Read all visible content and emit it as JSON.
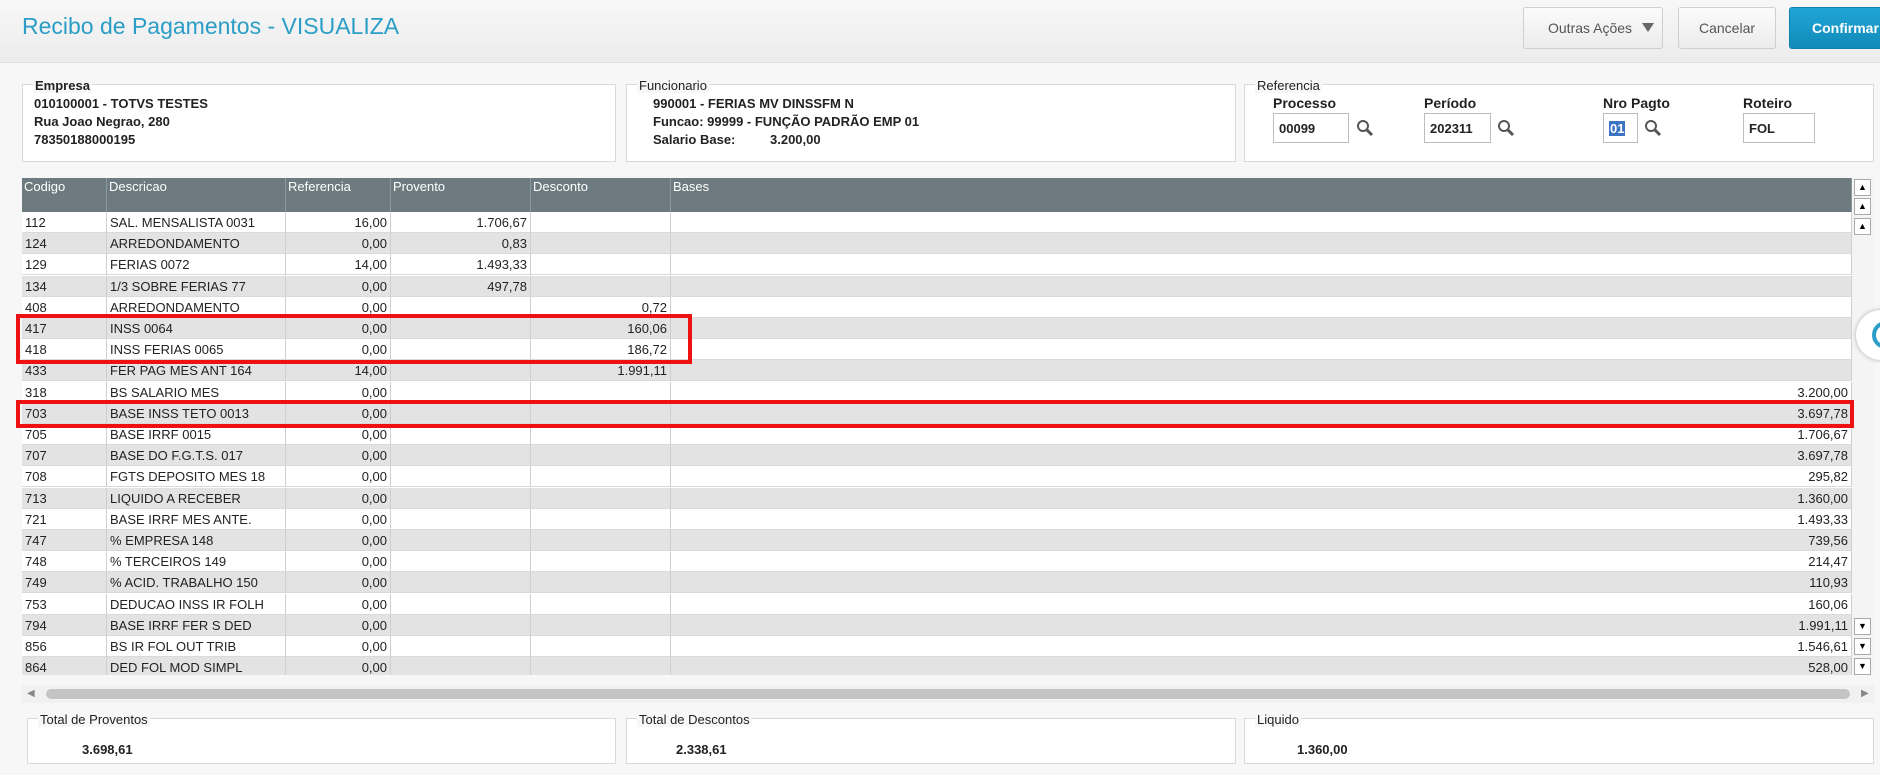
{
  "header": {
    "title": "Recibo de Pagamentos - VISUALIZA",
    "outras_acoes": "Outras Ações",
    "cancelar": "Cancelar",
    "confirmar": "Confirmar"
  },
  "empresa": {
    "legend": "Empresa",
    "line1": "010100001 - TOTVS TESTES",
    "line2": "Rua Joao Negrao, 280",
    "line3": "78350188000195"
  },
  "funcionario": {
    "legend": "Funcionario",
    "line1": "990001 - FERIAS MV DINSSFM N",
    "line2": "Funcao: 99999  - FUNÇÃO PADRÃO EMP 01",
    "salario_label": "Salario Base:",
    "salario_value": "3.200,00"
  },
  "referencia": {
    "legend": "Referencia",
    "processo_label": "Processo",
    "processo_value": "00099",
    "periodo_label": "Período",
    "periodo_value": "202311",
    "nro_label": "Nro Pagto",
    "nro_value": "01",
    "roteiro_label": "Roteiro",
    "roteiro_value": "FOL"
  },
  "grid": {
    "columns": [
      "Codigo",
      "Descricao",
      "Referencia",
      "Provento",
      "Desconto",
      "Bases"
    ],
    "rows": [
      [
        "112",
        "SAL. MENSALISTA 0031",
        "16,00",
        "1.706,67",
        "",
        ""
      ],
      [
        "124",
        "ARREDONDAMENTO",
        "0,00",
        "0,83",
        "",
        ""
      ],
      [
        "129",
        "FERIAS 0072",
        "14,00",
        "1.493,33",
        "",
        ""
      ],
      [
        "134",
        "1/3 SOBRE FERIAS 77",
        "0,00",
        "497,78",
        "",
        ""
      ],
      [
        "408",
        "ARREDONDAMENTO",
        "0,00",
        "",
        "0,72",
        ""
      ],
      [
        "417",
        "INSS 0064",
        "0,00",
        "",
        "160,06",
        ""
      ],
      [
        "418",
        "INSS FERIAS 0065",
        "0,00",
        "",
        "186,72",
        ""
      ],
      [
        "433",
        "FER PAG MES ANT 164",
        "14,00",
        "",
        "1.991,11",
        ""
      ],
      [
        "318",
        "BS SALARIO MES",
        "0,00",
        "",
        "",
        "3.200,00"
      ],
      [
        "703",
        "BASE INSS TETO 0013",
        "0,00",
        "",
        "",
        "3.697,78"
      ],
      [
        "705",
        "BASE IRRF 0015",
        "0,00",
        "",
        "",
        "1.706,67"
      ],
      [
        "707",
        "BASE DO F.G.T.S. 017",
        "0,00",
        "",
        "",
        "3.697,78"
      ],
      [
        "708",
        "FGTS DEPOSITO MES 18",
        "0,00",
        "",
        "",
        "295,82"
      ],
      [
        "713",
        "LIQUIDO A RECEBER",
        "0,00",
        "",
        "",
        "1.360,00"
      ],
      [
        "721",
        "BASE IRRF MES ANTE.",
        "0,00",
        "",
        "",
        "1.493,33"
      ],
      [
        "747",
        "% EMPRESA  148",
        "0,00",
        "",
        "",
        "739,56"
      ],
      [
        "748",
        "% TERCEIROS 149",
        "0,00",
        "",
        "",
        "214,47"
      ],
      [
        "749",
        "% ACID. TRABALHO 150",
        "0,00",
        "",
        "",
        "110,93"
      ],
      [
        "753",
        "DEDUCAO INSS IR FOLH",
        "0,00",
        "",
        "",
        "160,06"
      ],
      [
        "794",
        "BASE IRRF FER S DED",
        "0,00",
        "",
        "",
        "1.991,11"
      ],
      [
        "856",
        "BS IR FOL OUT TRIB",
        "0,00",
        "",
        "",
        "1.546,61"
      ],
      [
        "864",
        "DED FOL MOD SIMPL",
        "0,00",
        "",
        "",
        "528,00"
      ]
    ]
  },
  "totais": {
    "proventos_label": "Total de Proventos",
    "proventos_value": "3.698,61",
    "descontos_label": "Total de Descontos",
    "descontos_value": "2.338,61",
    "liquido_label": "Liquido",
    "liquido_value": "1.360,00"
  },
  "colors": {
    "title": "#2b9ec7",
    "confirm": "#1fa6d6",
    "grid_header": "#6d7b80",
    "highlight": "#ee1111"
  }
}
